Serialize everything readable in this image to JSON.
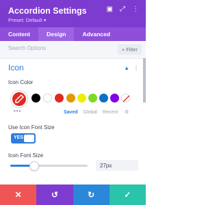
{
  "header": {
    "title": "Accordion Settings",
    "preset": "Preset: Default ▾",
    "icons": [
      "screen-icon",
      "expand-icon",
      "more-icon"
    ]
  },
  "tabs": [
    {
      "label": "Content",
      "active": false
    },
    {
      "label": "Design",
      "active": true
    },
    {
      "label": "Advanced",
      "active": false
    }
  ],
  "search": {
    "placeholder": "Search Options",
    "filter_label": "+ Filter"
  },
  "section": {
    "title": "Icon"
  },
  "icon_color": {
    "label": "Icon Color",
    "selected": "#e02b20",
    "swatches": [
      "#000000",
      "#ffffff",
      "#e02b20",
      "#e09900",
      "#edf000",
      "#7cda24",
      "#0c71c3",
      "#8300e9"
    ],
    "preset_tabs": [
      "Saved",
      "Global",
      "Recent"
    ],
    "active_preset_tab": "Saved"
  },
  "use_icon_font_size": {
    "label": "Use Icon Font Size",
    "toggle": "YES"
  },
  "icon_font_size": {
    "label": "Icon Font Size",
    "value": "27px",
    "slider_fraction": 0.3
  },
  "footer": {
    "buttons": [
      {
        "glyph": "✕",
        "color": "#ef5555"
      },
      {
        "glyph": "↺",
        "color": "#7e3bd0"
      },
      {
        "glyph": "↻",
        "color": "#2b87da"
      },
      {
        "glyph": "✓",
        "color": "#29c4a9"
      }
    ]
  },
  "colors": {
    "accent": "#2e7de0",
    "header": "#7e3bd0",
    "tabs": "#8f4fd9"
  }
}
